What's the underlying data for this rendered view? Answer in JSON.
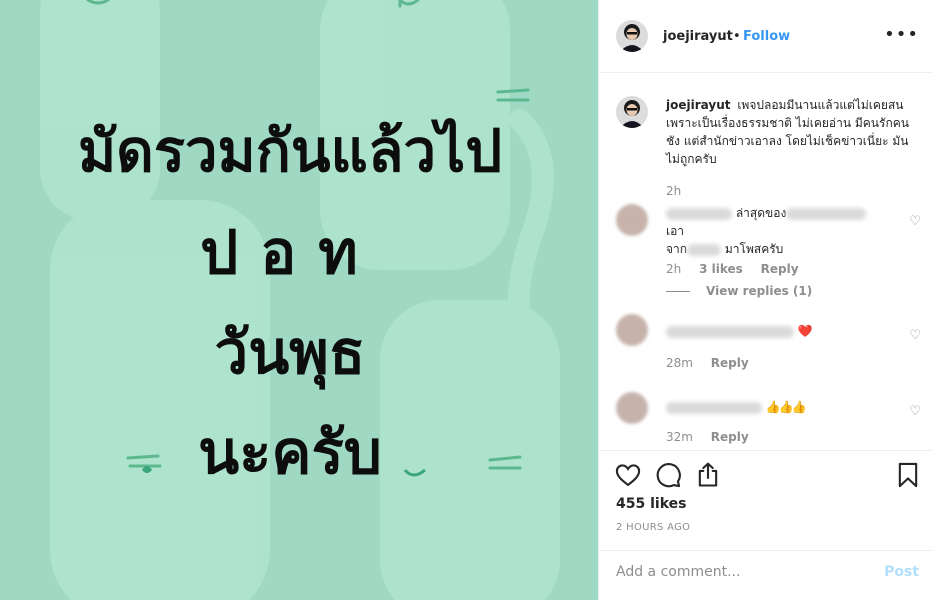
{
  "image": {
    "background_color": "#9fd9c4",
    "lines": [
      "มัดรวมกันแล้วไป",
      "ปอท",
      "วันพุธ",
      "นะครับ"
    ]
  },
  "post_header": {
    "username": "joejirayut",
    "separator": "•",
    "follow_label": "Follow",
    "more_icon": "more-options-icon"
  },
  "caption": {
    "username": "joejirayut",
    "text": "เพจปลอมมีนานแล้วแต่ไม่เคยสนเพราะเป็นเรื่องธรรมชาติ ไม่เคยอ่าน มีคนรักคนชัง แต่สำนักข่าวเอาลง โดยไม่เช็คข่าวเนี่ยะ มันไม่ถูกครับ",
    "time": "2h"
  },
  "comments": [
    {
      "text_a": "ล่าสุดของ",
      "text_b": "เอา",
      "text_c": "จาก",
      "text_d": "มาโพสครับ",
      "time": "2h",
      "likes": "3 likes",
      "reply": "Reply",
      "view_replies": "View replies (1)"
    },
    {
      "emoji": "❤️",
      "time": "28m",
      "reply": "Reply"
    },
    {
      "emoji": "👍👍👍",
      "time": "32m",
      "reply": "Reply"
    }
  ],
  "actions": {
    "likes": "455 likes",
    "time_ago": "2 HOURS AGO"
  },
  "add_comment": {
    "placeholder": "Add a comment...",
    "post_label": "Post"
  },
  "colors": {
    "accent": "#3897f0",
    "post_disabled": "#b2dffc",
    "muted": "#8e8e8e"
  }
}
